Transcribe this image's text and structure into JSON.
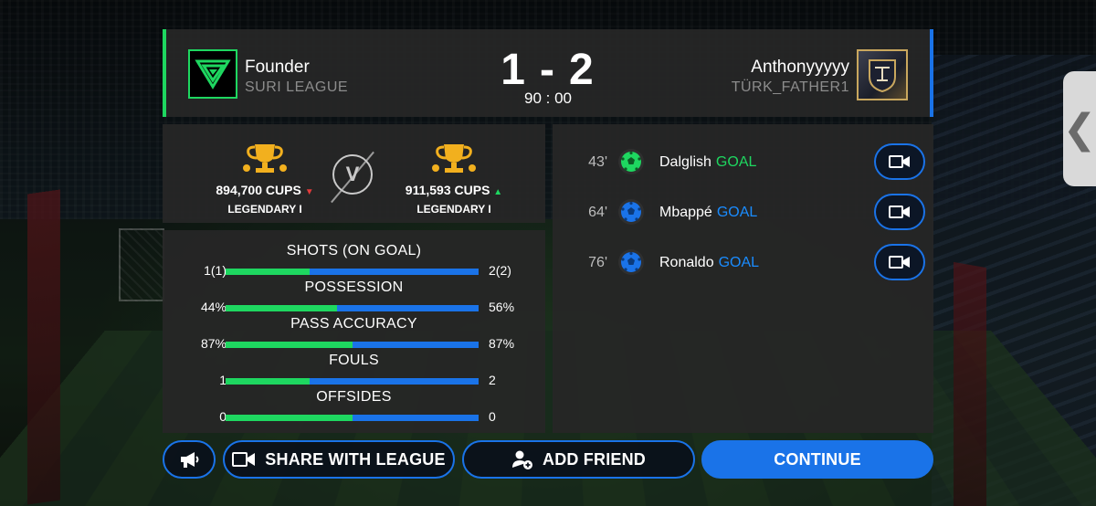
{
  "header": {
    "home": {
      "name": "Founder",
      "league": "SURI LEAGUE"
    },
    "away": {
      "name": "Anthonyyyyy",
      "league": "TÜRK_FATHER1"
    },
    "score": {
      "home": "1",
      "separator": "-",
      "away": "2"
    },
    "clock": "90 : 00"
  },
  "cups": {
    "home": {
      "value": "894,700 CUPS",
      "rank": "LEGENDARY I",
      "trend": "down"
    },
    "away": {
      "value": "911,593 CUPS",
      "rank": "LEGENDARY I",
      "trend": "up"
    },
    "vs_label": "V"
  },
  "stats": [
    {
      "title": "SHOTS (ON GOAL)",
      "home": "1(1)",
      "away": "2(2)",
      "home_fraction": 0.333
    },
    {
      "title": "POSSESSION",
      "home": "44%",
      "away": "56%",
      "home_fraction": 0.44
    },
    {
      "title": "PASS ACCURACY",
      "home": "87%",
      "away": "87%",
      "home_fraction": 0.5
    },
    {
      "title": "FOULS",
      "home": "1",
      "away": "2",
      "home_fraction": 0.333
    },
    {
      "title": "OFFSIDES",
      "home": "0",
      "away": "0",
      "home_fraction": 0.5
    }
  ],
  "goals": [
    {
      "minute": "43'",
      "player": "Dalglish",
      "tag": "GOAL",
      "team": "home"
    },
    {
      "minute": "64'",
      "player": "Mbappé",
      "tag": "GOAL",
      "team": "away"
    },
    {
      "minute": "76'",
      "player": "Ronaldo",
      "tag": "GOAL",
      "team": "away"
    }
  ],
  "buttons": {
    "share": "SHARE WITH LEAGUE",
    "add_friend": "ADD FRIEND",
    "continue": "CONTINUE"
  },
  "colors": {
    "home_accent": "#1ed760",
    "away_accent": "#1a73e8",
    "panel": "#262626",
    "muted_text": "#8c8c8c",
    "trend_down": "#e23b3b",
    "trend_up": "#1ed760"
  },
  "icons": {
    "side_handle": "chevron-left-icon",
    "announce": "megaphone-icon",
    "share": "video-camera-icon",
    "add_friend": "add-user-icon",
    "replay": "video-camera-icon",
    "ball": "football-icon",
    "cup": "trophy-icon"
  }
}
